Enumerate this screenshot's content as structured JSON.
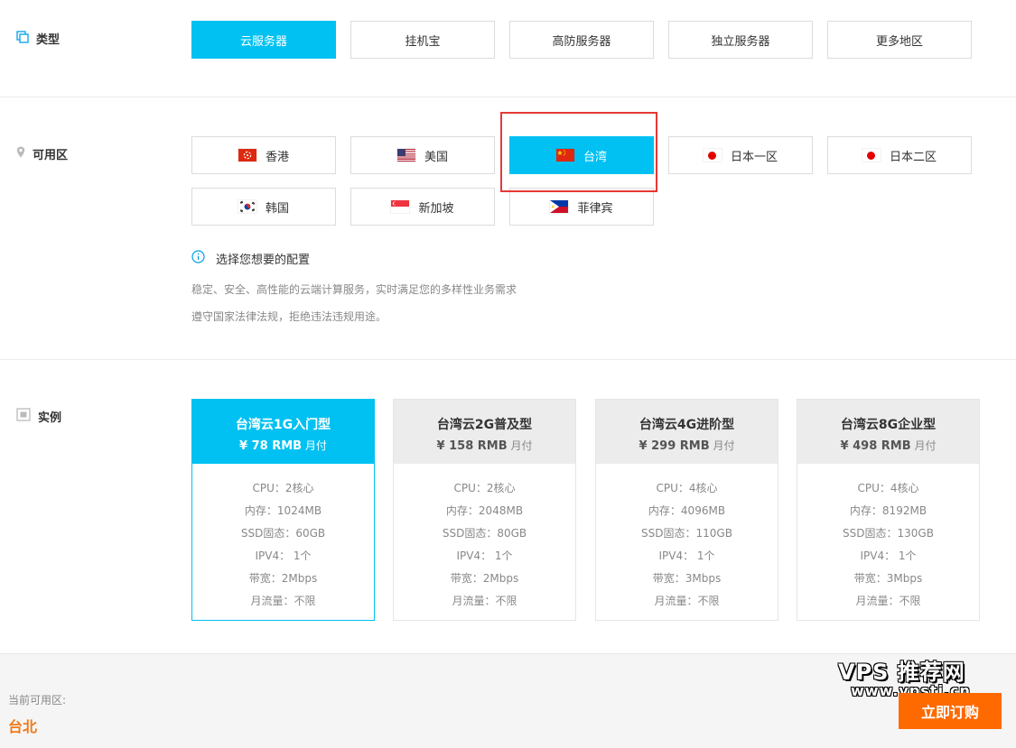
{
  "type_section": {
    "label": "类型",
    "options": [
      "云服务器",
      "挂机宝",
      "高防服务器",
      "独立服务器",
      "更多地区"
    ]
  },
  "zone_section": {
    "label": "可用区",
    "options": [
      {
        "flag": "hongkong",
        "label": "香港"
      },
      {
        "flag": "usa",
        "label": "美国"
      },
      {
        "flag": "china",
        "label": "台湾"
      },
      {
        "flag": "japan",
        "label": "日本一区"
      },
      {
        "flag": "japan",
        "label": "日本二区"
      },
      {
        "flag": "korea",
        "label": "韩国"
      },
      {
        "flag": "singapore",
        "label": "新加坡"
      },
      {
        "flag": "philippines",
        "label": "菲律宾"
      }
    ]
  },
  "info": {
    "title": "选择您想要的配置",
    "line1": "稳定、安全、高性能的云端计算服务，实时满足您的多样性业务需求",
    "line2": "遵守国家法律法规，拒绝违法违规用途。"
  },
  "instance_section": {
    "label": "实例",
    "cards": [
      {
        "name": "台湾云1G入门型",
        "price": "¥ 78 RMB",
        "period": "月付",
        "specs": [
          "CPU：2核心",
          "内存：1024MB",
          "SSD固态：60GB",
          "IPV4： 1个",
          "带宽：2Mbps",
          "月流量：不限"
        ]
      },
      {
        "name": "台湾云2G普及型",
        "price": "¥ 158 RMB",
        "period": "月付",
        "specs": [
          "CPU：2核心",
          "内存：2048MB",
          "SSD固态：80GB",
          "IPV4： 1个",
          "带宽：2Mbps",
          "月流量：不限"
        ]
      },
      {
        "name": "台湾云4G进阶型",
        "price": "¥ 299 RMB",
        "period": "月付",
        "specs": [
          "CPU：4核心",
          "内存：4096MB",
          "SSD固态：110GB",
          "IPV4： 1个",
          "带宽：3Mbps",
          "月流量：不限"
        ]
      },
      {
        "name": "台湾云8G企业型",
        "price": "¥ 498 RMB",
        "period": "月付",
        "specs": [
          "CPU：4核心",
          "内存：8192MB",
          "SSD固态：130GB",
          "IPV4： 1个",
          "带宽：3Mbps",
          "月流量：不限"
        ]
      }
    ]
  },
  "footer": {
    "current_zone_label": "当前可用区:",
    "current_zone_value": "台北",
    "order_button": "立即订购"
  },
  "watermark": {
    "title": "VPS 推荐网",
    "url": "www.vpstj.cn"
  },
  "colors": {
    "accent": "#00c1f2",
    "order": "#ff6a00",
    "zone_value": "#f07a1a",
    "highlight_box": "#e53935"
  }
}
